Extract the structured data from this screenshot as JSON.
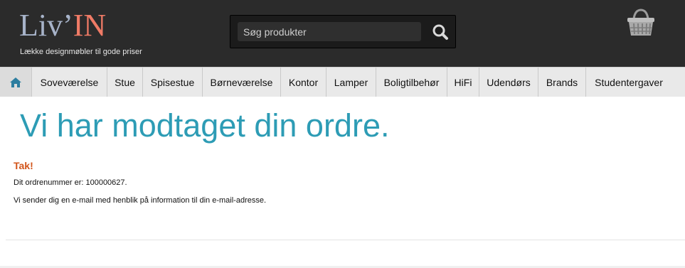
{
  "header": {
    "logo": {
      "part1": "Liv’",
      "part2": "IN"
    },
    "tagline": "Lække designmøbler til gode priser",
    "search": {
      "placeholder": "Søg produkter",
      "value": ""
    },
    "icons": {
      "search": "search-icon",
      "basket": "basket-icon",
      "home": "home-icon"
    }
  },
  "nav": {
    "items": [
      {
        "label": "Soveværelse"
      },
      {
        "label": "Stue"
      },
      {
        "label": "Spisestue"
      },
      {
        "label": "Børneværelse"
      },
      {
        "label": "Kontor"
      },
      {
        "label": "Lamper"
      },
      {
        "label": "Boligtilbehør"
      },
      {
        "label": "HiFi"
      },
      {
        "label": "Udendørs"
      },
      {
        "label": "Brands"
      },
      {
        "label": "Studentergaver"
      }
    ]
  },
  "main": {
    "title": "Vi har modtaget din ordre.",
    "thanks": "Tak!",
    "order_line": "Dit ordrenummer er: 100000627.",
    "info_line": "Vi sender dig en e-mail med henblik på information til din e-mail-adresse."
  },
  "colors": {
    "header_bg": "#2b2b2b",
    "nav_bg": "#e9e9e9",
    "title": "#2d9cb5",
    "thanks": "#d2551b",
    "logo_blue": "#a7b3c9",
    "logo_coral": "#f07b66"
  }
}
